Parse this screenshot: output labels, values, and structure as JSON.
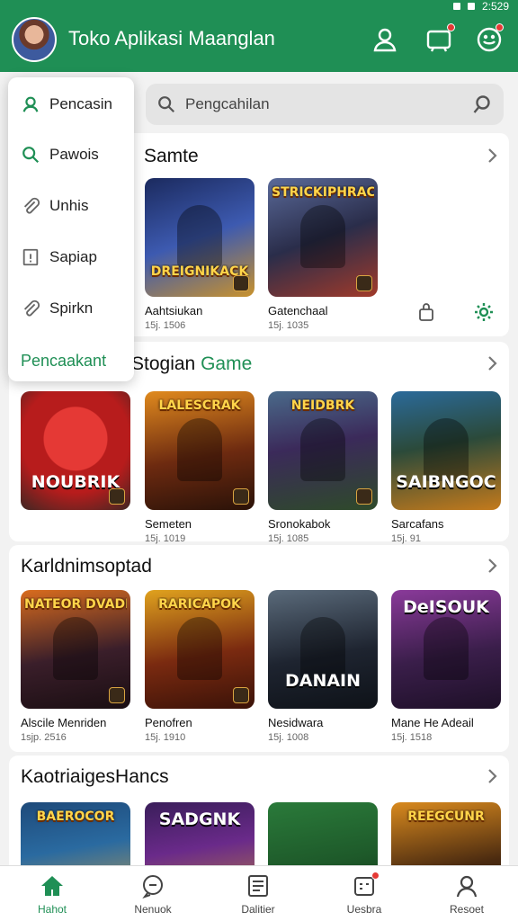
{
  "status_bar": {
    "time": "2:529"
  },
  "app_bar": {
    "title": "Toko Aplikasi Maanglan"
  },
  "search": {
    "placeholder": "Pengcahilan"
  },
  "menu": {
    "items": [
      {
        "label": "Pencasin",
        "icon": "person-outline-icon"
      },
      {
        "label": "Pawois",
        "icon": "search-icon"
      },
      {
        "label": "Unhis",
        "icon": "paperclip-icon"
      },
      {
        "label": "Sapiap",
        "icon": "alert-box-icon"
      },
      {
        "label": "Spirkn",
        "icon": "paperclip-icon"
      }
    ],
    "footer": "Pencaakant"
  },
  "sections": [
    {
      "title": "Samte",
      "cards": [
        {
          "name": "Aahtsiukan",
          "meta": "15j. 1506",
          "art": "DREIGNIKACK",
          "colors": [
            "#1b2a5e",
            "#c9922c"
          ]
        },
        {
          "name": "Gatenchaal",
          "meta": "15j. 1035",
          "art": "STRICKIPHRACK",
          "colors": [
            "#2a2d4a",
            "#a13a2a"
          ]
        }
      ]
    },
    {
      "title": "Stogian",
      "title_accent": "Game",
      "cards": [
        {
          "name": "",
          "meta": "",
          "art": "NOUBRIK",
          "colors": [
            "#b71c1c",
            "#3e2723"
          ]
        },
        {
          "name": "Semeten",
          "meta": "15j. 1019",
          "art": "LALESCRAK",
          "colors": [
            "#6d2a10",
            "#e08a1e"
          ]
        },
        {
          "name": "Sronokabok",
          "meta": "15j. 1085",
          "art": "NEIDBRK",
          "colors": [
            "#2e4a2a",
            "#3b2a5a"
          ]
        },
        {
          "name": "Sarcafans",
          "meta": "15j. 91",
          "art": "SAIBNGOC",
          "colors": [
            "#2b4a3a",
            "#c47a1c"
          ]
        }
      ]
    },
    {
      "title": "Karldnimsoptad",
      "cards": [
        {
          "name": "Alscile Menriden",
          "meta": "1sjp. 2516",
          "art": "NATEOR DVADICUA",
          "colors": [
            "#3a1e2a",
            "#d96c1e"
          ]
        },
        {
          "name": "Penofren",
          "meta": "15j. 1910",
          "art": "RARICAPOK",
          "colors": [
            "#7a2a10",
            "#e0a21e"
          ]
        },
        {
          "name": "Nesidwara",
          "meta": "15j. 1008",
          "art": "DANAIN",
          "colors": [
            "#1e2430",
            "#5a6a7a"
          ]
        },
        {
          "name": "Mane He Adeail",
          "meta": "15j. 1518",
          "art": "DeISOUK",
          "colors": [
            "#3a1e4a",
            "#8a3a9a"
          ]
        }
      ]
    },
    {
      "title": "KaotriaigesHancs",
      "cards": [
        {
          "art": "BAEROCOR",
          "colors": [
            "#1e4a7a",
            "#d9a441"
          ]
        },
        {
          "art": "SADGNK",
          "colors": [
            "#3a1e5a",
            "#c9922c"
          ]
        },
        {
          "art": "",
          "colors": [
            "#1e5a2a",
            "#2a7a3a"
          ]
        },
        {
          "art": "REEGCUNR",
          "colors": [
            "#4a2a10",
            "#d98a1e"
          ]
        }
      ]
    }
  ],
  "bottom_nav": [
    {
      "label": "Hahot",
      "icon": "home-icon",
      "active": true
    },
    {
      "label": "Nenuok",
      "icon": "chat-bubble-icon",
      "active": false
    },
    {
      "label": "Dalitier",
      "icon": "document-icon",
      "active": false
    },
    {
      "label": "Uesbra",
      "icon": "calendar-box-icon",
      "active": false
    },
    {
      "label": "Resoet",
      "icon": "person-icon",
      "active": false
    }
  ],
  "colors": {
    "primary": "#1f8f55",
    "badge": "#e53935"
  }
}
